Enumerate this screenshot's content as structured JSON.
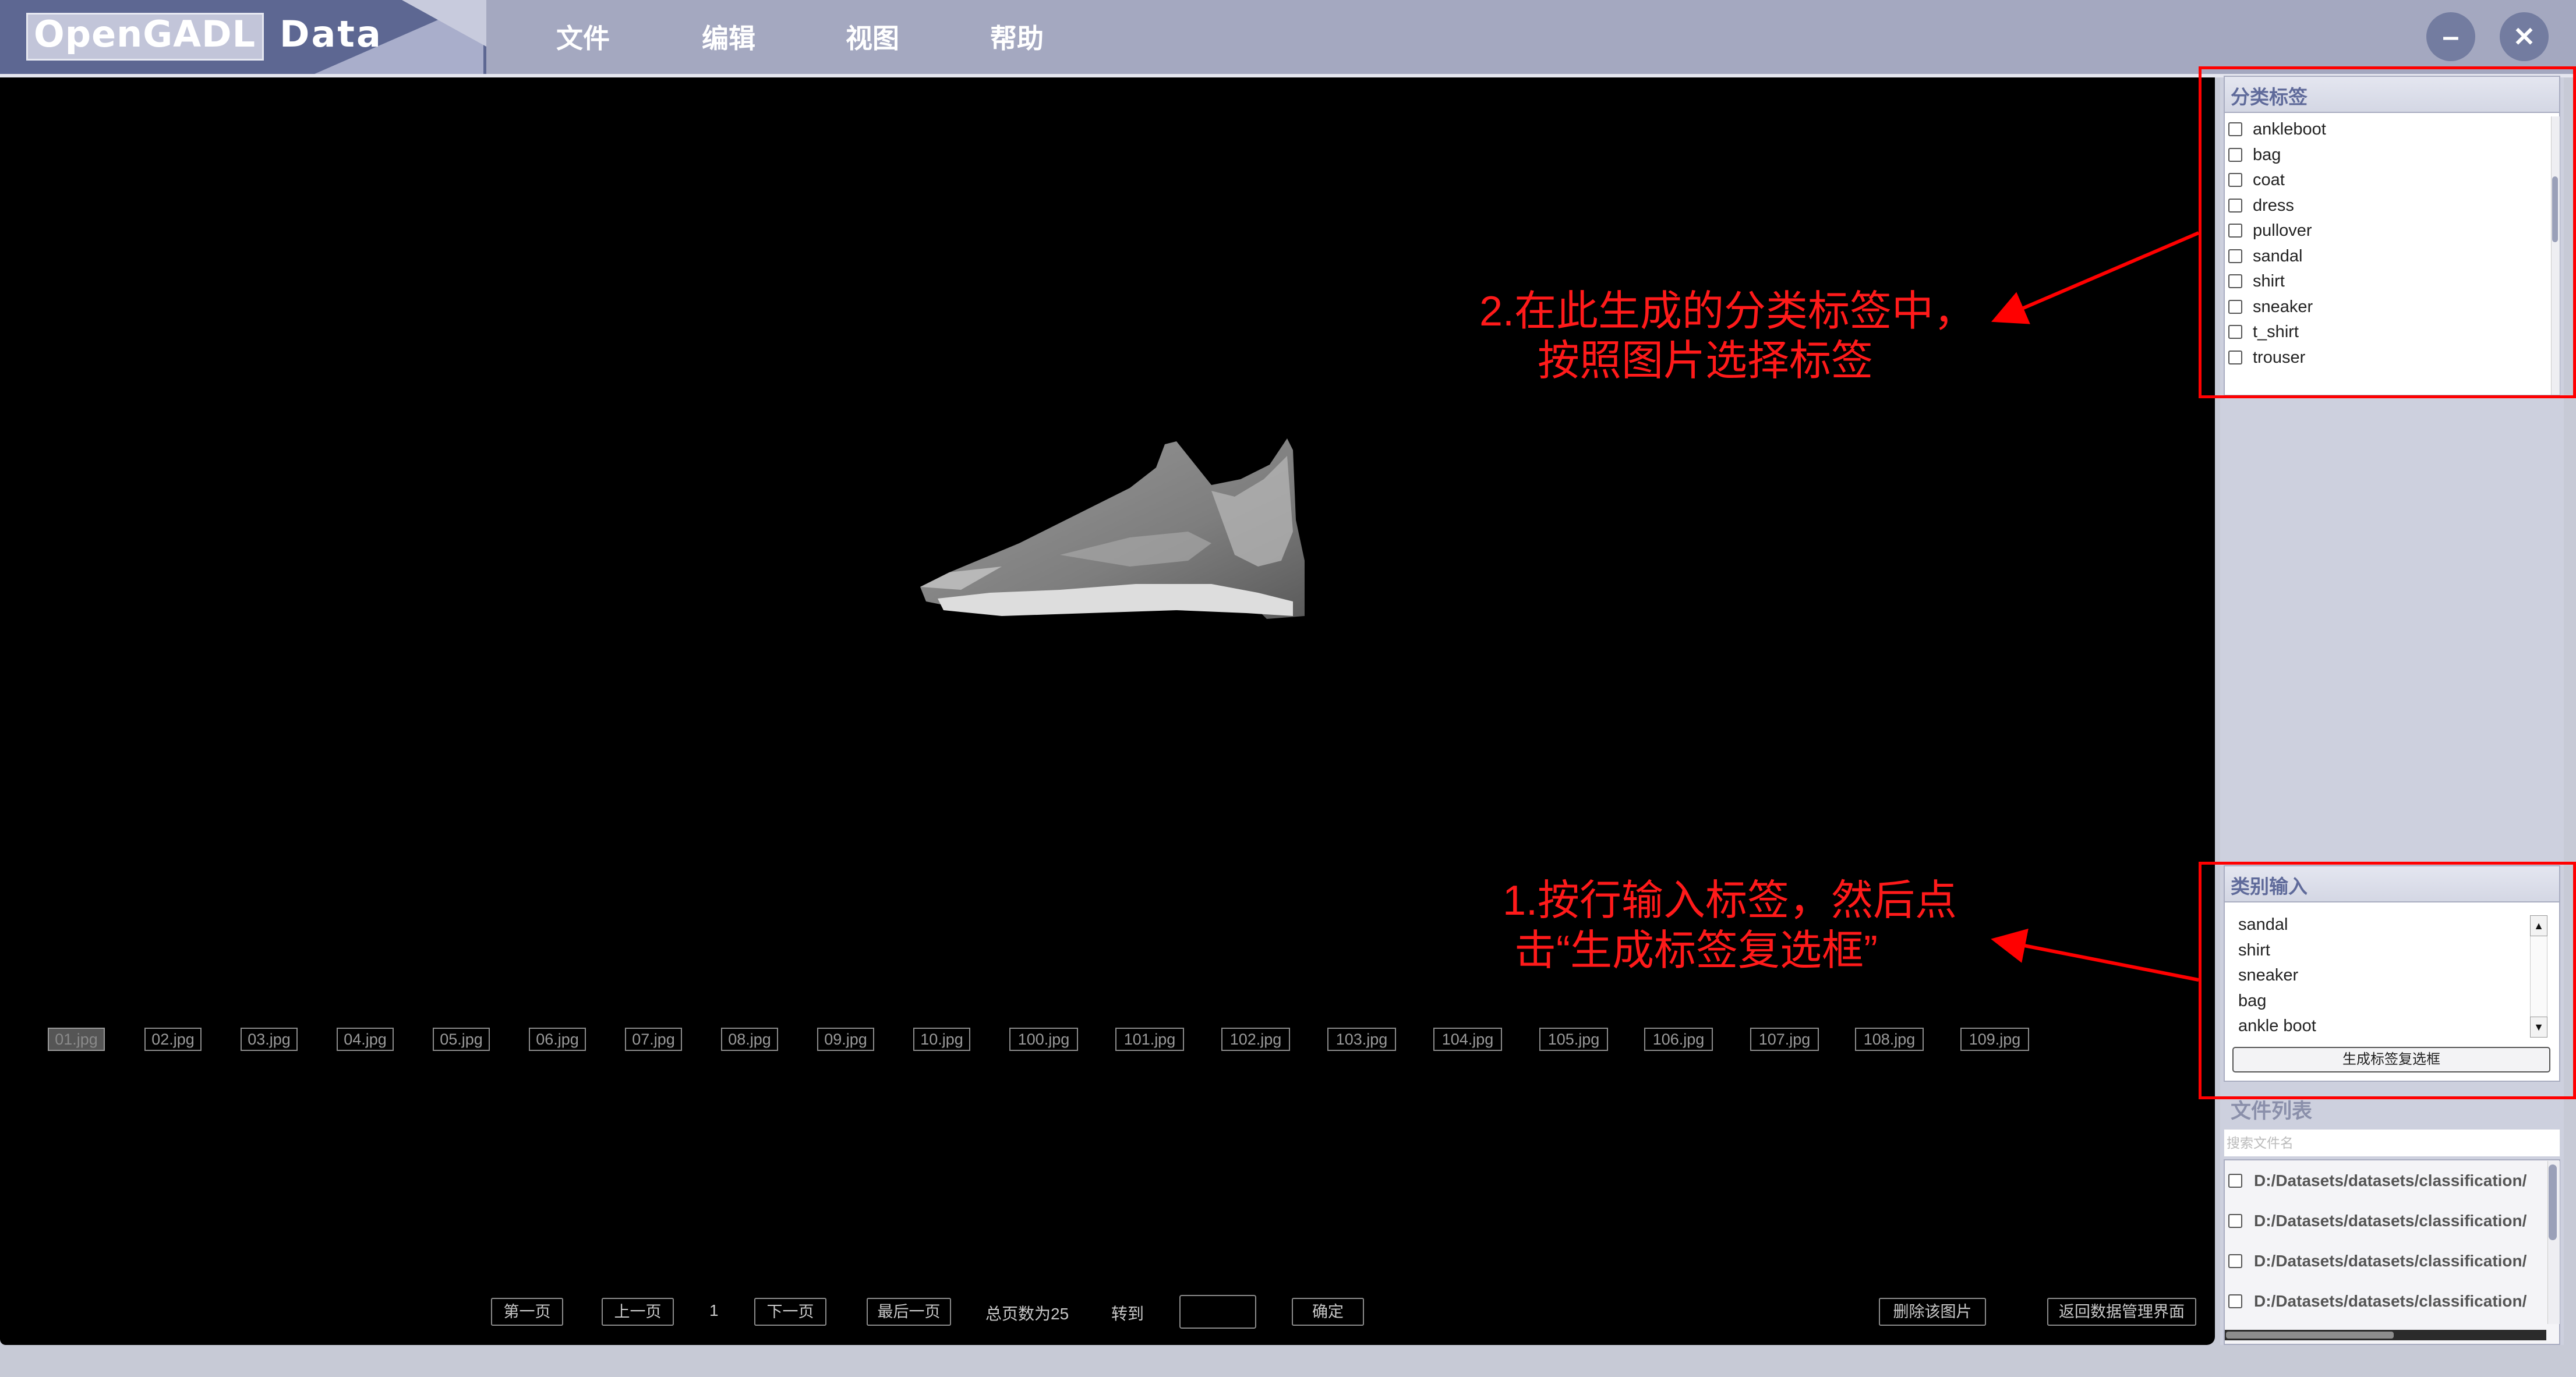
{
  "app": {
    "brand": "OpenGADL",
    "brand_suffix": "Data"
  },
  "menu": [
    "文件",
    "编辑",
    "视图",
    "帮助"
  ],
  "window_controls": {
    "minimize": "–",
    "close": "✕"
  },
  "thumbnails": [
    "01.jpg",
    "02.jpg",
    "03.jpg",
    "04.jpg",
    "05.jpg",
    "06.jpg",
    "07.jpg",
    "08.jpg",
    "09.jpg",
    "10.jpg",
    "100.jpg",
    "101.jpg",
    "102.jpg",
    "103.jpg",
    "104.jpg",
    "105.jpg",
    "106.jpg",
    "107.jpg",
    "108.jpg",
    "109.jpg"
  ],
  "pager": {
    "first": "第一页",
    "prev": "上一页",
    "current": "1",
    "next": "下一页",
    "last": "最后一页",
    "total": "总页数为25",
    "goto": "转到",
    "goto_value": "",
    "confirm": "确定",
    "delete": "删除该图片",
    "back": "返回数据管理界面"
  },
  "labels_panel": {
    "title": "分类标签",
    "items": [
      "ankleboot",
      "bag",
      "coat",
      "dress",
      "pullover",
      "sandal",
      "shirt",
      "sneaker",
      "t_shirt",
      "trouser"
    ]
  },
  "category_input": {
    "title": "类别输入",
    "lines": [
      "sandal",
      "shirt",
      "sneaker",
      "bag",
      "ankle boot"
    ],
    "generate_button": "生成标签复选框"
  },
  "file_list": {
    "title": "文件列表",
    "search_placeholder": "搜索文件名",
    "items": [
      "D:/Datasets/datasets/classification/",
      "D:/Datasets/datasets/classification/",
      "D:/Datasets/datasets/classification/",
      "D:/Datasets/datasets/classification/"
    ]
  },
  "annotations": {
    "step2_line1": "2.在此生成的分类标签中，",
    "step2_line2": "按照图片选择标签",
    "step1_line1": "1.按行输入标签，然后点",
    "step1_line2": "击“生成标签复选框”",
    "color": "#ff0000"
  },
  "colors": {
    "topbar": "#a4a8c0",
    "panel": "#cdd0de",
    "accent": "#5f6a9a"
  }
}
